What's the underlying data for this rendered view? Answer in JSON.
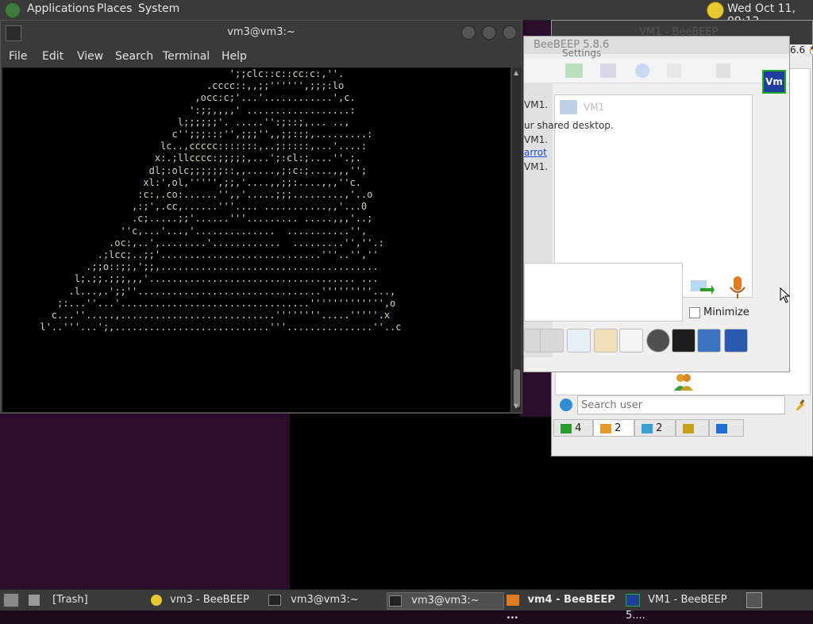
{
  "top_panel": {
    "menus": [
      "Applications",
      "Places",
      "System"
    ],
    "clock": "Wed Oct 11, 09:12"
  },
  "terminal": {
    "title": "vm3@vm3:~",
    "menu": [
      "File",
      "Edit",
      "View",
      "Search",
      "Terminal",
      "Help"
    ],
    "output": "                                       ';;clc::c::cc:c:,''.\n                                   .cccc::,,;;'''''',;;;:lo\n                                 ,occ:c;'...'............',c.\n                                ':;;,,,,' ..................:\n                              l;;;;;;'. .....'':;::;,... ..,\n                             c'';;;:::'',;;;'',,;;::;,.........:\n                           lc..,ccccc:::::::,..;:::::,...'....:\n                          x:.;llcccc:;;;;;,...';:cl:;....''.;.\n                         dl;:olc;;;;;;::,,.....,;:c:;....,,,'';\n                        xl:',ol,''''',;;,'....,,;;:....,,,''c.\n                       :c:,.co:......'',,'.....;;;.........,'..o\n                      ,:;',.cc,......'''.... ...........,,'...0\n                      .c;.....;;'......'''......... .....,,,'..;\n                    ''c,...'...,'..............  ...........'',\n                  .oc:,..',........'............  .........'',''.:\n                .;lcc;..;;'............................'''..'',''\n              .;;o::;;,';;,......................................\n            l;.;;.;;;,,,'.................................... ...\n           .l...,.';;''................................'''''''''...,\n         ;:...''...'.................................''''''''''''',o\n        c...''.....,...........................''''''''.....'''''.x\n      l'..'''...';,...........................'''...............''..c"
  },
  "beebeep_back": {
    "title": "VM1 - BeeBEEP",
    "version_fragment": "6.6",
    "search_placeholder": "Search user",
    "tabs": [
      {
        "icon": "users-online-icon",
        "count": "4"
      },
      {
        "icon": "users-icon",
        "count": "2"
      },
      {
        "icon": "chats-icon",
        "count": "2"
      },
      {
        "icon": "groups-icon",
        "count": ""
      },
      {
        "icon": "share-icon",
        "count": ""
      }
    ]
  },
  "beebeep_front": {
    "title": "BeeBEEP 5.8.6",
    "menu_fragment": "Settings",
    "vm_label": "VM1",
    "chat_lines": [
      "VM1.",
      "ur shared desktop.",
      "VM1.",
      "arrot",
      "VM1."
    ],
    "minimize_label": "Minimize",
    "avatar_text": "Vm"
  },
  "taskbar": {
    "items": [
      {
        "label": "[Trash]",
        "icon": "trash-icon",
        "active": false
      },
      {
        "label": "vm3 - BeeBEEP",
        "icon": "bee-icon",
        "active": false
      },
      {
        "label": "vm3@vm3:~",
        "icon": "terminal-icon",
        "active": false
      },
      {
        "label": "vm3@vm3:~",
        "icon": "terminal-icon",
        "active": true
      },
      {
        "label": "vm4 - BeeBEEP ...",
        "icon": "vm-icon",
        "active": false
      },
      {
        "label": "VM1 - BeeBEEP 5....",
        "icon": "vm-icon",
        "active": false
      }
    ]
  },
  "colors": {
    "panel": "#3a3a3a",
    "desktop_purple": "#2b0d2b",
    "terminal_bg": "#000000",
    "beebeep_accent": "#1f6fd0",
    "vm_green": "#22aa22"
  }
}
